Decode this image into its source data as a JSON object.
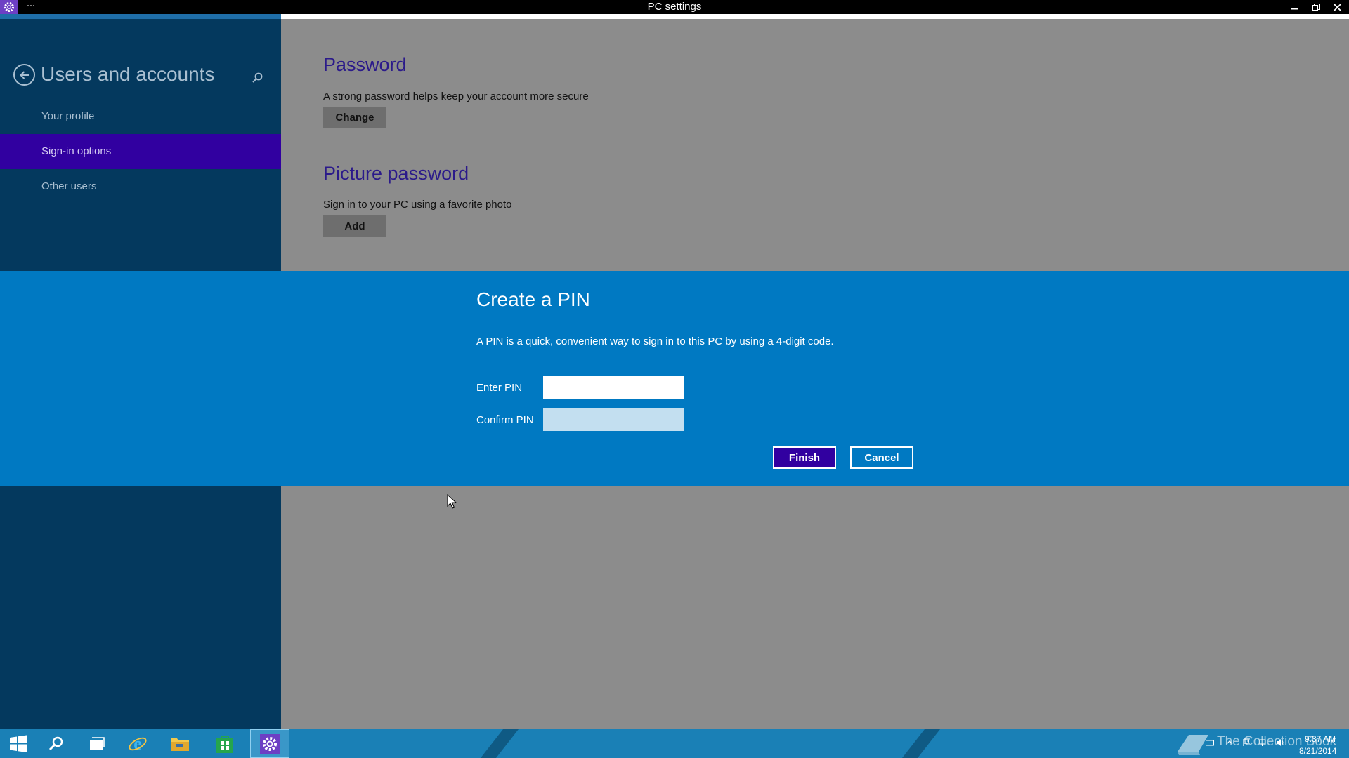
{
  "window": {
    "title": "PC settings",
    "menu_glyph": "···"
  },
  "sidebar": {
    "title": "Users and accounts",
    "items": [
      {
        "label": "Your profile",
        "active": false
      },
      {
        "label": "Sign-in options",
        "active": true
      },
      {
        "label": "Other users",
        "active": false
      }
    ]
  },
  "main": {
    "password": {
      "title": "Password",
      "desc": "A strong password helps keep your account more secure",
      "button": "Change"
    },
    "picture_password": {
      "title": "Picture password",
      "desc": "Sign in to your PC using a favorite photo",
      "button": "Add"
    }
  },
  "dialog": {
    "title": "Create a PIN",
    "desc": "A PIN is a quick, convenient way to sign in to this PC by using a 4-digit code.",
    "enter_label": "Enter PIN",
    "enter_value": "",
    "confirm_label": "Confirm PIN",
    "confirm_value": "",
    "finish": "Finish",
    "cancel": "Cancel"
  },
  "taskbar": {
    "items": [
      "start-icon",
      "search-icon",
      "task-view-icon",
      "internet-explorer-icon",
      "file-explorer-icon",
      "store-icon",
      "settings-icon"
    ],
    "active_item": "settings-icon",
    "time": "9:37 AM",
    "date": "8/21/2014",
    "watermark": "The Collection Book"
  },
  "colors": {
    "sidebar": "#04395e",
    "nav_active": "#3100a0",
    "dialog": "#0079c2",
    "content_bg": "#8c8c8c",
    "taskbar": "#1a80b6"
  }
}
